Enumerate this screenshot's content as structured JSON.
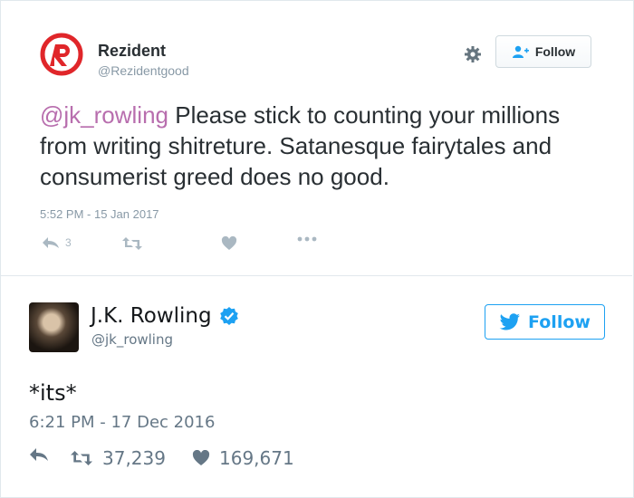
{
  "tweet1": {
    "name": "Rezident",
    "handle": "@Rezidentgood",
    "follow_label": "Follow",
    "mention": "@jk_rowling",
    "text": " Please stick to counting your millions from writing shitreture. Satanesque fairytales and consumerist greed does no good.",
    "timestamp": "5:52 PM - 15 Jan 2017",
    "reply_count": "3",
    "icons": [
      "gear-icon",
      "follow-person-icon",
      "reply-icon",
      "retweet-icon",
      "like-icon",
      "more-icon"
    ],
    "colors": {
      "brand_red": "#e0262a",
      "mention": "#b86eae",
      "muted": "#8899a6"
    }
  },
  "tweet2": {
    "name": "J.K. Rowling",
    "handle": "@jk_rowling",
    "follow_label": "Follow",
    "text": "*its*",
    "timestamp": "6:21 PM - 17 Dec 2016",
    "retweets": "37,239",
    "likes": "169,671",
    "icons": [
      "verified-badge-icon",
      "twitter-bird-icon",
      "reply-icon",
      "retweet-icon",
      "heart-icon"
    ],
    "colors": {
      "accent": "#1da1f2",
      "muted": "#657786"
    }
  }
}
